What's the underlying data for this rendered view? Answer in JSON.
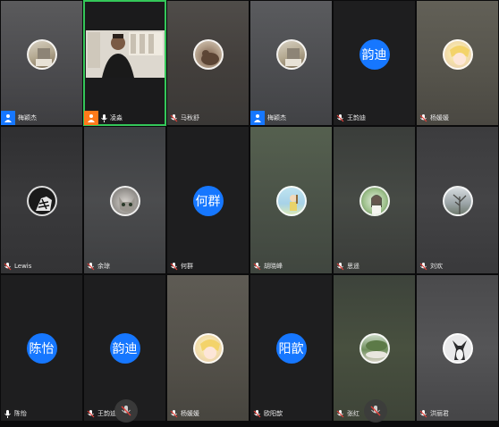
{
  "participants": [
    {
      "name": "梅颖杰",
      "avatar": "landscape-avatar",
      "badge": "host",
      "mic": "on"
    },
    {
      "name": "凌淼",
      "avatar": "video",
      "badge": "cohost",
      "mic": "on",
      "speaking": true
    },
    {
      "name": "马秋舒",
      "avatar": "cat-avatar",
      "badge": "none",
      "mic": "muted"
    },
    {
      "name": "梅颖杰",
      "avatar": "landscape-avatar",
      "badge": "host",
      "mic": "on"
    },
    {
      "name": "王韵迪",
      "avatar_text": "韵迪",
      "badge": "none",
      "mic": "muted"
    },
    {
      "name": "杨媛媛",
      "avatar": "anime-avatar",
      "badge": "none",
      "mic": "muted"
    },
    {
      "name": "Lewis",
      "avatar": "zebra-avatar",
      "badge": "none",
      "mic": "muted"
    },
    {
      "name": "余琼",
      "avatar": "kitten-avatar",
      "badge": "none",
      "mic": "muted"
    },
    {
      "name": "何群",
      "avatar_text": "何群",
      "badge": "none",
      "mic": "muted"
    },
    {
      "name": "胡晓峰",
      "avatar": "figure-avatar",
      "badge": "none",
      "mic": "muted"
    },
    {
      "name": "思遥",
      "avatar": "girl-avatar",
      "badge": "none",
      "mic": "muted"
    },
    {
      "name": "刘欢",
      "avatar": "tree-avatar",
      "badge": "none",
      "mic": "muted"
    },
    {
      "name": "陈怡",
      "avatar_text": "陈怡",
      "badge": "none",
      "mic": "on"
    },
    {
      "name": "王韵迪",
      "avatar_text": "韵迪",
      "badge": "none",
      "mic": "muted"
    },
    {
      "name": "杨媛媛",
      "avatar": "anime-avatar",
      "badge": "none",
      "mic": "muted"
    },
    {
      "name": "欧阳歆",
      "avatar_text": "阳歆",
      "badge": "none",
      "mic": "muted"
    },
    {
      "name": "张红",
      "avatar": "garden-avatar",
      "badge": "none",
      "mic": "muted"
    },
    {
      "name": "洪丽君",
      "avatar": "dog-avatar",
      "badge": "none",
      "mic": "muted"
    }
  ],
  "colors": {
    "accent": "#1677ff",
    "cohost": "#ff7a1a",
    "speaking_border": "#34c759",
    "mute_red": "#e0403a"
  }
}
